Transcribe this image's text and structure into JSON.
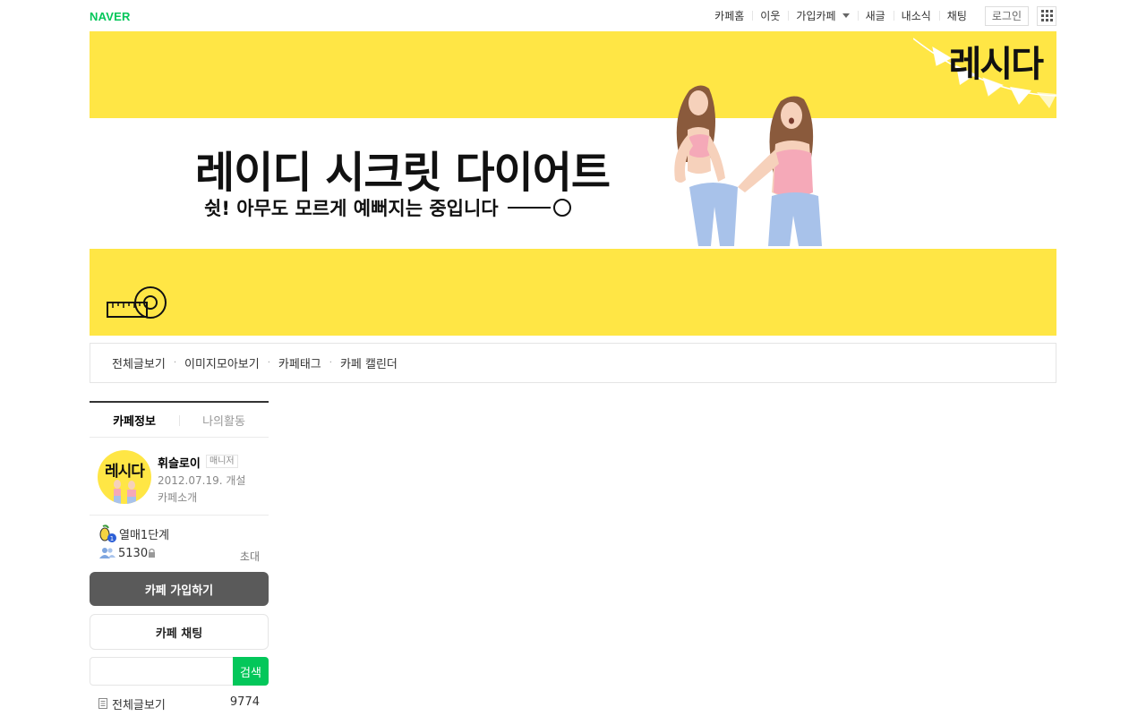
{
  "gnb": {
    "logo": "NAVER",
    "menu": [
      "카페홈",
      "이웃",
      "가입카페",
      "새글",
      "내소식",
      "채팅"
    ],
    "login_label": "로그인",
    "apps_icon": "grid-icon"
  },
  "banner": {
    "logo_text": "레시다",
    "title": "레이디 시크릿 다이어트",
    "subtitle": "쉿! 아무도 모르게 예뻐지는 중입니다",
    "accent_color": "#ffe645"
  },
  "board_menu": {
    "items": [
      "전체글보기",
      "이미지모아보기",
      "카페태그",
      "카페 캘린더"
    ]
  },
  "sidebar": {
    "tabs": [
      "카페정보",
      "나의활동"
    ],
    "manager": {
      "thumb_text": "레시다",
      "name": "휘슬로이",
      "badge": "매니저",
      "open_date": "2012.07.19. 개설",
      "intro_link": "카페소개"
    },
    "level": "열매1단계",
    "member_count": "5130",
    "invite_label": "초대",
    "join_button": "카페 가입하기",
    "chat_button": "카페 채팅",
    "search": {
      "value": "",
      "button": "검색"
    },
    "all_posts": {
      "label": "전체글보기",
      "count": "9774"
    }
  }
}
